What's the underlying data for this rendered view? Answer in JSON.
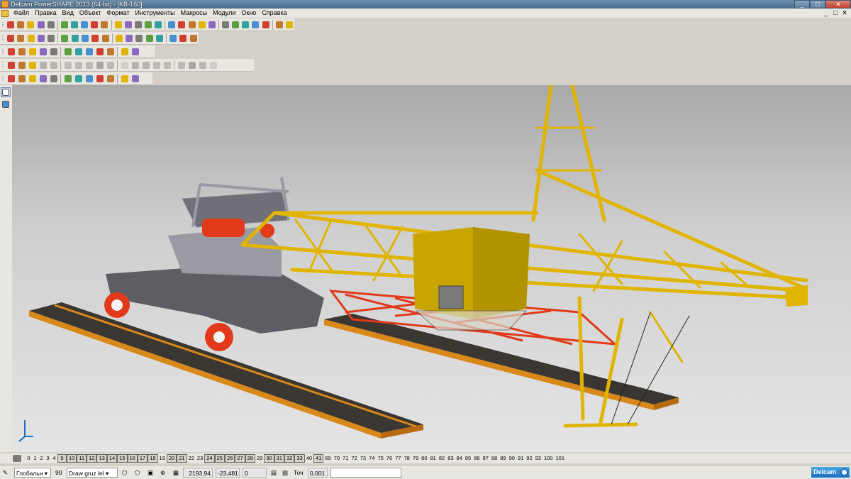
{
  "window": {
    "title": "Delcam PowerSHAPE 2013 (64-bit) - [KB-160]",
    "buttons": [
      "_",
      "□",
      "✕"
    ]
  },
  "menu": {
    "items": [
      "Файл",
      "Правка",
      "Вид",
      "Объект",
      "Формат",
      "Инструменты",
      "Макросы",
      "Модули",
      "Окно",
      "Справка"
    ],
    "mdi_buttons": [
      "_",
      "□",
      "✕"
    ]
  },
  "toolbars": {
    "row1_icons": [
      "new-icon",
      "open-icon",
      "save-icon",
      "print-icon",
      "cut-icon",
      "copy-icon",
      "paste-icon",
      "delete-icon",
      "select-icon",
      "zoom-icon",
      "zoom-box-icon",
      "pan-icon",
      "rotate-icon",
      "shade-icon",
      "render-icon",
      "undo-icon",
      "redo-icon",
      "redraw-icon",
      "workplane-icon",
      "line-icon",
      "arc-icon",
      "circle-icon",
      "curve-icon",
      "surface-icon",
      "solid-icon",
      "mesh-icon",
      "wireframe-icon"
    ],
    "row2_icons": [
      "view-top-icon",
      "view-front-icon",
      "view-side-icon",
      "view-iso-icon",
      "view-back-icon",
      "view-bottom-icon",
      "shaded-icon",
      "wire-icon",
      "hidden-icon",
      "material-icon",
      "light-icon",
      "clip-icon"
    ],
    "row3_icons": [
      "solid-box-icon",
      "solid-cyl-icon",
      "solid-cone-icon",
      "solid-sphere-icon",
      "solid-torus-icon",
      "extrude-icon",
      "revolve-icon",
      "sweep-icon",
      "boolean-add-icon",
      "boolean-sub-icon",
      "boolean-int-icon",
      "fillet-icon",
      "chamfer-icon",
      "shell-icon",
      "draft-icon",
      "cut-icon",
      "split-icon",
      "hole-icon",
      "boss-icon"
    ],
    "row4_icons": [
      "assembly-icon",
      "axes-icon",
      "component-icon",
      "mate-icon",
      "instance-icon",
      "move-icon",
      "copy-component-icon",
      "explode-icon",
      "pattern-icon",
      "bom-icon",
      "constraint-icon",
      "check-icon"
    ]
  },
  "left_strip": [
    "select-arrow-icon",
    "quick-select-icon"
  ],
  "levels": [
    {
      "label": "0",
      "used": false
    },
    {
      "label": "1",
      "used": false
    },
    {
      "label": "2",
      "used": false
    },
    {
      "label": "3",
      "used": false
    },
    {
      "label": "4",
      "used": false
    },
    {
      "label": "9",
      "used": true
    },
    {
      "label": "10",
      "used": true
    },
    {
      "label": "11",
      "used": true
    },
    {
      "label": "12",
      "used": true
    },
    {
      "label": "13",
      "used": true
    },
    {
      "label": "14",
      "used": true
    },
    {
      "label": "15",
      "used": true
    },
    {
      "label": "16",
      "used": true
    },
    {
      "label": "17",
      "used": true
    },
    {
      "label": "18",
      "used": true
    },
    {
      "label": "19",
      "used": false
    },
    {
      "label": "20",
      "used": true
    },
    {
      "label": "21",
      "used": true
    },
    {
      "label": "22",
      "used": false
    },
    {
      "label": "23",
      "used": false
    },
    {
      "label": "24",
      "used": true
    },
    {
      "label": "25",
      "used": true
    },
    {
      "label": "26",
      "used": true
    },
    {
      "label": "27",
      "used": true
    },
    {
      "label": "28",
      "used": true
    },
    {
      "label": "29",
      "used": false
    },
    {
      "label": "30",
      "used": true
    },
    {
      "label": "31",
      "used": true
    },
    {
      "label": "32",
      "used": true
    },
    {
      "label": "33",
      "used": true
    },
    {
      "label": "40",
      "used": false
    },
    {
      "label": "41",
      "used": true
    },
    {
      "label": "69",
      "used": false
    },
    {
      "label": "70",
      "used": false
    },
    {
      "label": "71",
      "used": false
    },
    {
      "label": "72",
      "used": false
    },
    {
      "label": "73",
      "used": false
    },
    {
      "label": "74",
      "used": false
    },
    {
      "label": "75",
      "used": false
    },
    {
      "label": "76",
      "used": false
    },
    {
      "label": "77",
      "used": false
    },
    {
      "label": "78",
      "used": false
    },
    {
      "label": "79",
      "used": false
    },
    {
      "label": "80",
      "used": false
    },
    {
      "label": "81",
      "used": false
    },
    {
      "label": "82",
      "used": false
    },
    {
      "label": "83",
      "used": false
    },
    {
      "label": "84",
      "used": false
    },
    {
      "label": "85",
      "used": false
    },
    {
      "label": "86",
      "used": false
    },
    {
      "label": "87",
      "used": false
    },
    {
      "label": "88",
      "used": false
    },
    {
      "label": "89",
      "used": false
    },
    {
      "label": "90",
      "used": false
    },
    {
      "label": "91",
      "used": false
    },
    {
      "label": "92",
      "used": false
    },
    {
      "label": "93",
      "used": false
    },
    {
      "label": "100",
      "used": false
    },
    {
      "label": "101",
      "used": false
    }
  ],
  "status": {
    "workplane": "Глобальн",
    "level_number": "90",
    "level_name": "Draw gruz lel",
    "x": "2193,94",
    "y": "-23,481",
    "z": "0",
    "tolerance_label": "Точ",
    "tolerance": "0,001",
    "brand": "Delcam"
  },
  "colors": {
    "crane_yellow": "#e0b400",
    "crane_red": "#e03a1a",
    "crane_grey": "#7a7a80",
    "rail_orange": "#d9881a",
    "accent_blue": "#1a70c0"
  }
}
